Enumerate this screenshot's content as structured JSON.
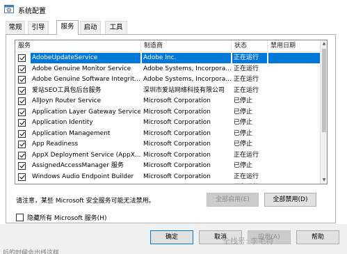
{
  "window": {
    "title": "系统配置"
  },
  "tabs": [
    {
      "label": "常规"
    },
    {
      "label": "引导"
    },
    {
      "label": "服务"
    },
    {
      "label": "启动"
    },
    {
      "label": "工具"
    }
  ],
  "list": {
    "headers": {
      "name": "服务",
      "maker": "制造商",
      "status": "状态",
      "date": "禁用日期"
    },
    "rows": [
      {
        "name": "AdobeUpdateService",
        "maker": "Adobe Inc.",
        "status": "正在运行",
        "date": "",
        "checked": true
      },
      {
        "name": "Adobe Genuine Monitor Service",
        "maker": "Adobe Systems, Incorpora...",
        "status": "正在运行",
        "date": "",
        "checked": true
      },
      {
        "name": "Adobe Genuine Software Integrit...",
        "maker": "Adobe Systems, Incorpora...",
        "status": "正在运行",
        "date": "",
        "checked": true
      },
      {
        "name": "爱站SEO工具包后台服务",
        "maker": "深圳市爱站网络科技有限公司",
        "status": "正在运行",
        "date": "",
        "checked": true
      },
      {
        "name": "AllJoyn Router Service",
        "maker": "Microsoft Corporation",
        "status": "已停止",
        "date": "",
        "checked": true
      },
      {
        "name": "Application Layer Gateway Service",
        "maker": "Microsoft Corporation",
        "status": "已停止",
        "date": "",
        "checked": true
      },
      {
        "name": "Application Identity",
        "maker": "Microsoft Corporation",
        "status": "已停止",
        "date": "",
        "checked": true
      },
      {
        "name": "Application Management",
        "maker": "Microsoft Corporation",
        "status": "已停止",
        "date": "",
        "checked": true
      },
      {
        "name": "App Readiness",
        "maker": "Microsoft Corporation",
        "status": "已停止",
        "date": "",
        "checked": true
      },
      {
        "name": "AppX Deployment Service (AppX...",
        "maker": "Microsoft Corporation",
        "status": "正在运行",
        "date": "",
        "checked": true
      },
      {
        "name": "AssignedAccessManager 服务",
        "maker": "Microsoft Corporation",
        "status": "已停止",
        "date": "",
        "checked": true
      },
      {
        "name": "Windows Audio Endpoint Builder",
        "maker": "Microsoft Corporation",
        "status": "正在运行",
        "date": "",
        "checked": true
      },
      {
        "name": "Windows Audio",
        "maker": "Microsoft Corporation",
        "status": "正在运行",
        "date": "",
        "checked": true
      }
    ]
  },
  "notice": "请注意，某些 Microsoft 安全服务可能无法禁用。",
  "buttons": {
    "enable_all": "全部启用(E)",
    "disable_all": "全部禁用(D)",
    "ok": "确定",
    "cancel": "取消",
    "apply": "应用(A)",
    "help": "帮助"
  },
  "hide_ms": {
    "label": "隐藏所有 Microsoft 服务(H)",
    "checked": false
  },
  "cutoff_text": "后的时候会出线这样",
  "watermark": "全栈号: 李毛特",
  "colors": {
    "selection": "#0078d7",
    "accent_border": "#0078d7"
  },
  "icons": {
    "app": "gear-window-icon"
  }
}
